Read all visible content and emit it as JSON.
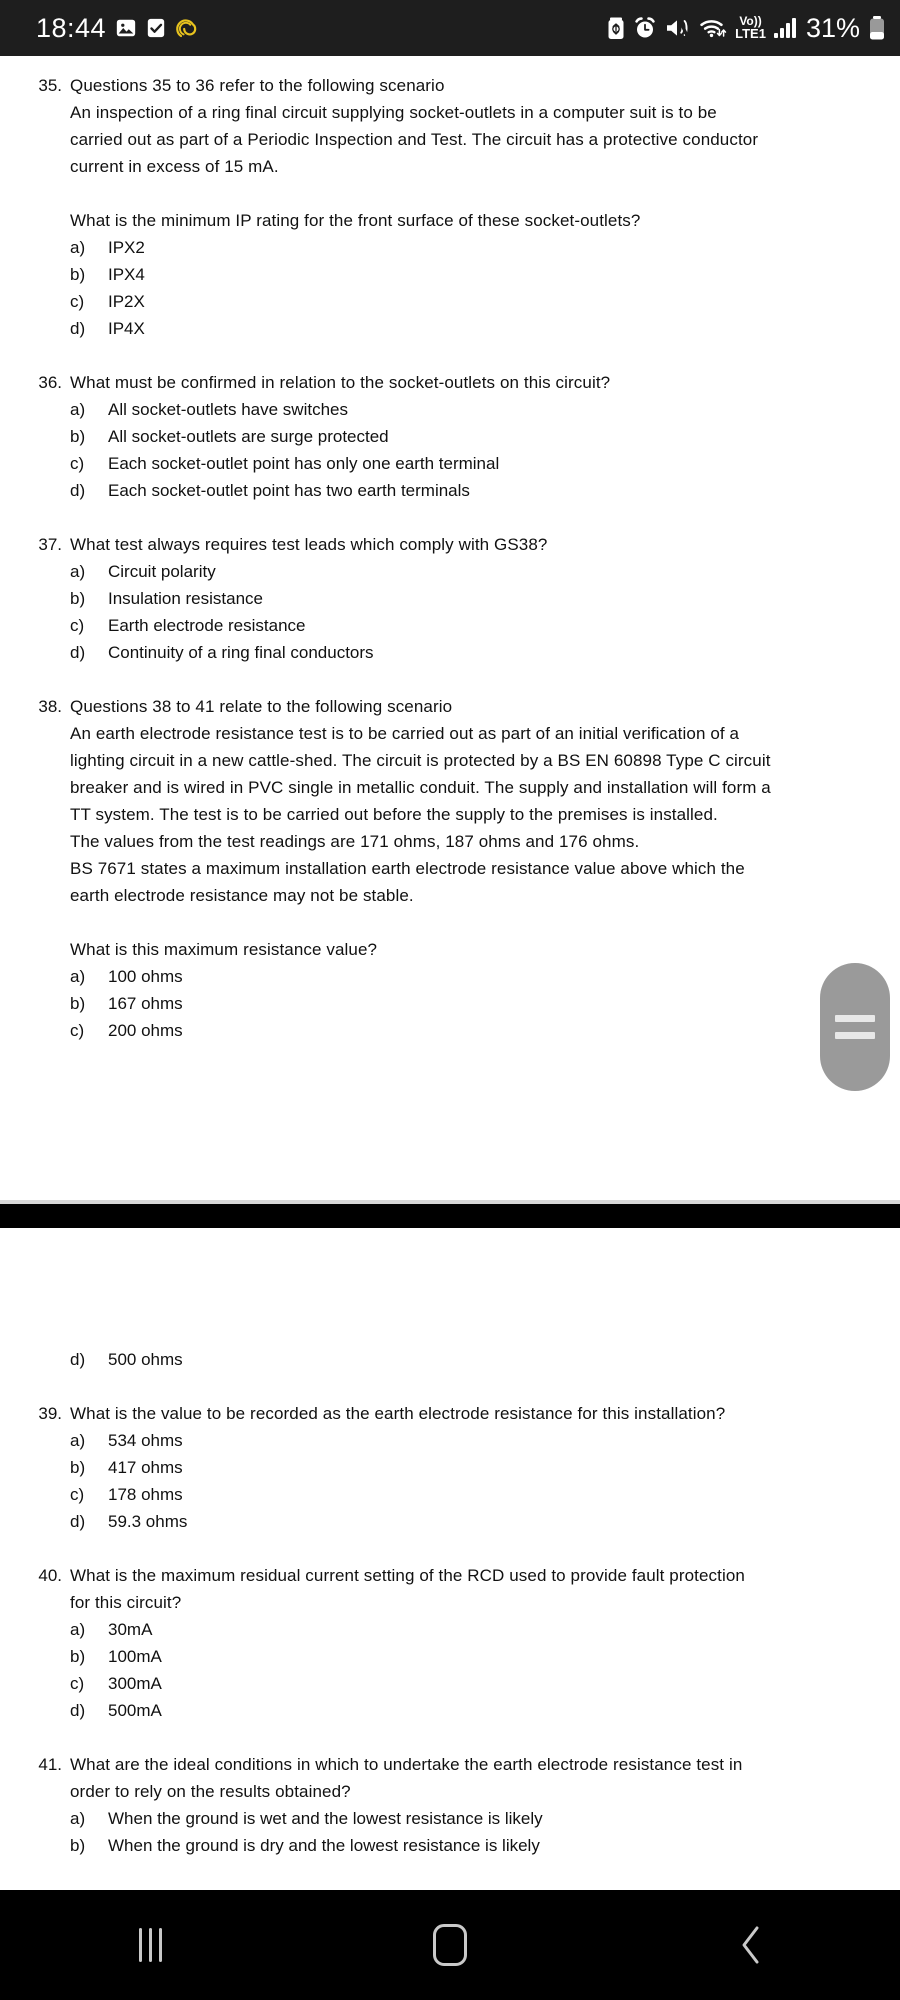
{
  "statusbar": {
    "clock": "18:44",
    "left_icons": [
      "photo-icon",
      "checkbox-icon",
      "pocket-icon"
    ],
    "right_icons": [
      "battery-saver-icon",
      "alarm-icon",
      "mute-vibrate-icon",
      "wifi-icon"
    ],
    "volte_line1": "Vo))",
    "volte_line2": "LTE1",
    "signal_icon": "signal-bars-icon",
    "battery_percent": "31%",
    "battery_icon": "battery-icon"
  },
  "document": {
    "questions": [
      {
        "number": "35.",
        "heading": "Questions 35 to 36 refer to the following scenario",
        "body": [
          "An inspection of a ring final circuit supplying socket-outlets in a computer suit is to be",
          "carried out as part of a Periodic Inspection and Test. The circuit has a protective conductor",
          "current in excess of 15 mA."
        ],
        "prompt": "What is the minimum IP rating for the front surface of these socket-outlets?",
        "options": [
          {
            "label": "a)",
            "text": "IPX2"
          },
          {
            "label": "b)",
            "text": "IPX4"
          },
          {
            "label": "c)",
            "text": "IP2X"
          },
          {
            "label": "d)",
            "text": "IP4X"
          }
        ]
      },
      {
        "number": "36.",
        "heading": "What must be confirmed in relation to the socket-outlets on this circuit?",
        "options": [
          {
            "label": "a)",
            "text": "All socket-outlets have switches"
          },
          {
            "label": "b)",
            "text": "All socket-outlets are surge protected"
          },
          {
            "label": "c)",
            "text": "Each socket-outlet point has only one earth terminal"
          },
          {
            "label": "d)",
            "text": "Each socket-outlet point has two earth terminals"
          }
        ]
      },
      {
        "number": "37.",
        "heading": "What test always requires test leads which comply with GS38?",
        "options": [
          {
            "label": "a)",
            "text": "Circuit polarity"
          },
          {
            "label": "b)",
            "text": "Insulation resistance"
          },
          {
            "label": "c)",
            "text": "Earth electrode resistance"
          },
          {
            "label": "d)",
            "text": "Continuity of a ring final conductors"
          }
        ]
      },
      {
        "number": "38.",
        "heading": "Questions 38 to 41 relate to the following scenario",
        "body": [
          "An earth electrode resistance test is to be carried out as part of an initial verification of a",
          "lighting circuit in a new cattle-shed. The circuit is protected by a BS EN 60898 Type C circuit",
          "breaker and is wired in PVC single in metallic conduit. The supply and installation will form a",
          "TT system. The test is to be carried out before the supply to the premises is installed.",
          "The values from the test readings are 171 ohms, 187 ohms and 176 ohms.",
          "BS 7671 states a maximum installation earth electrode resistance value above which the",
          "earth electrode resistance may not be stable."
        ],
        "prompt": "What is this maximum resistance value?",
        "options": [
          {
            "label": "a)",
            "text": "100 ohms"
          },
          {
            "label": "b)",
            "text": "167 ohms"
          },
          {
            "label": "c)",
            "text": "200 ohms"
          }
        ]
      }
    ],
    "continued_option": {
      "label": "d)",
      "text": "500 ohms"
    },
    "questions_lower": [
      {
        "number": "39.",
        "heading": "What is the value to be recorded as the earth electrode resistance for this installation?",
        "options": [
          {
            "label": "a)",
            "text": "534 ohms"
          },
          {
            "label": "b)",
            "text": "417 ohms"
          },
          {
            "label": "c)",
            "text": "178 ohms"
          },
          {
            "label": "d)",
            "text": "59.3 ohms"
          }
        ]
      },
      {
        "number": "40.",
        "heading": "What is the maximum residual current setting of the RCD used to provide fault protection",
        "heading2": "for this circuit?",
        "options": [
          {
            "label": "a)",
            "text": "30mA"
          },
          {
            "label": "b)",
            "text": "100mA"
          },
          {
            "label": "c)",
            "text": "300mA"
          },
          {
            "label": "d)",
            "text": "500mA"
          }
        ]
      },
      {
        "number": "41.",
        "heading": "What are the ideal conditions in which to undertake the earth electrode resistance test in",
        "heading2": "order to rely on the results obtained?",
        "options": [
          {
            "label": "a)",
            "text": "When the ground is wet and the lowest resistance is likely"
          },
          {
            "label": "b)",
            "text": "When the ground is dry and the lowest resistance is likely"
          }
        ]
      }
    ]
  },
  "scrollbar": {
    "name": "scroll-thumb"
  },
  "navbar": {
    "recents_icon": "recents-icon",
    "home_icon": "home-icon",
    "back_icon": "back-icon"
  },
  "colors": {
    "statusbar_bg": "#1e1e1e",
    "page_bg": "#ffffff",
    "text": "#111111",
    "scroll_thumb": "#9a9a9a",
    "navbar_bg": "#000000",
    "accent_pocket": "#e8c31e"
  }
}
